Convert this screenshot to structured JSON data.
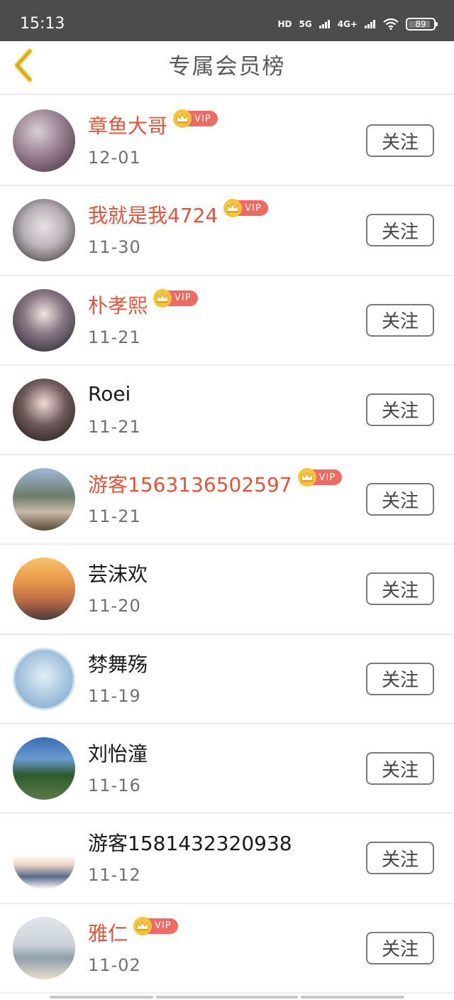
{
  "status_bar": {
    "time": "15:13",
    "hd_label": "HD",
    "signal_5g": "5G",
    "signal_4g": "4G+",
    "battery_level": "89",
    "battery_fraction": 0.89
  },
  "header": {
    "title": "专属会员榜",
    "back_icon": "chevron-left-icon",
    "accent_color": "#f2c12e"
  },
  "vip_badge_label": "VIP",
  "colors": {
    "vip_name": "#e0553a",
    "vip_badge": "#f06a63",
    "crown": "#f6c43a"
  },
  "members": [
    {
      "name": "章鱼大哥",
      "date": "12-01",
      "vip": true,
      "follow_label": "关注"
    },
    {
      "name": "我就是我4724",
      "date": "11-30",
      "vip": true,
      "follow_label": "关注"
    },
    {
      "name": "朴孝熙",
      "date": "11-21",
      "vip": true,
      "follow_label": "关注"
    },
    {
      "name": "Roei",
      "date": "11-21",
      "vip": false,
      "follow_label": "关注"
    },
    {
      "name": "游客1563136502597",
      "date": "11-21",
      "vip": true,
      "follow_label": "关注"
    },
    {
      "name": "芸沫欢",
      "date": "11-20",
      "vip": false,
      "follow_label": "关注"
    },
    {
      "name": "棼舞殇",
      "date": "11-19",
      "vip": false,
      "follow_label": "关注"
    },
    {
      "name": "刘怡潼",
      "date": "11-16",
      "vip": false,
      "follow_label": "关注"
    },
    {
      "name": "游客1581432320938",
      "date": "11-12",
      "vip": false,
      "follow_label": "关注"
    },
    {
      "name": "雅仁",
      "date": "11-02",
      "vip": true,
      "follow_label": "关注"
    }
  ]
}
